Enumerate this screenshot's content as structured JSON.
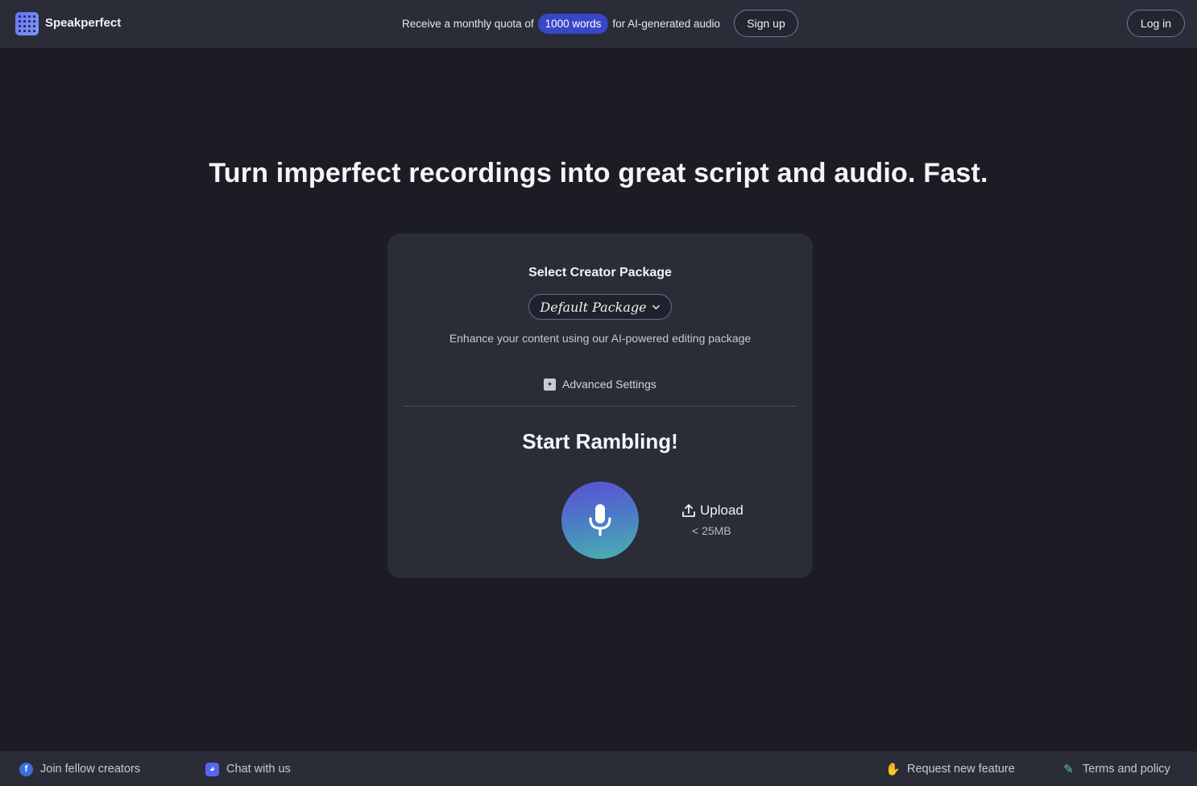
{
  "header": {
    "brand": "Speakperfect",
    "promo_prefix": "Receive a monthly quota of",
    "promo_highlight": "1000 words",
    "promo_suffix": "for AI-generated audio",
    "signup_label": "Sign up",
    "login_label": "Log in"
  },
  "hero": {
    "headline": "Turn imperfect recordings into great script and audio. Fast."
  },
  "card": {
    "title": "Select Creator Package",
    "package_selected": "Default Package",
    "description": "Enhance your content using our AI-powered editing package",
    "advanced_label": "Advanced Settings",
    "start_label": "Start Rambling!",
    "upload_label": "Upload",
    "upload_limit": "< 25MB"
  },
  "footer": {
    "items": [
      {
        "label": "Join fellow creators",
        "icon": "facebook-icon"
      },
      {
        "label": "Chat with us",
        "icon": "discord-icon"
      },
      {
        "label": "Request new feature",
        "icon": "hand-icon"
      },
      {
        "label": "Terms and policy",
        "icon": "document-edit-icon"
      }
    ]
  },
  "colors": {
    "accent": "#3a46c8",
    "background": "#1c1d24",
    "card": "#2a2d37"
  }
}
